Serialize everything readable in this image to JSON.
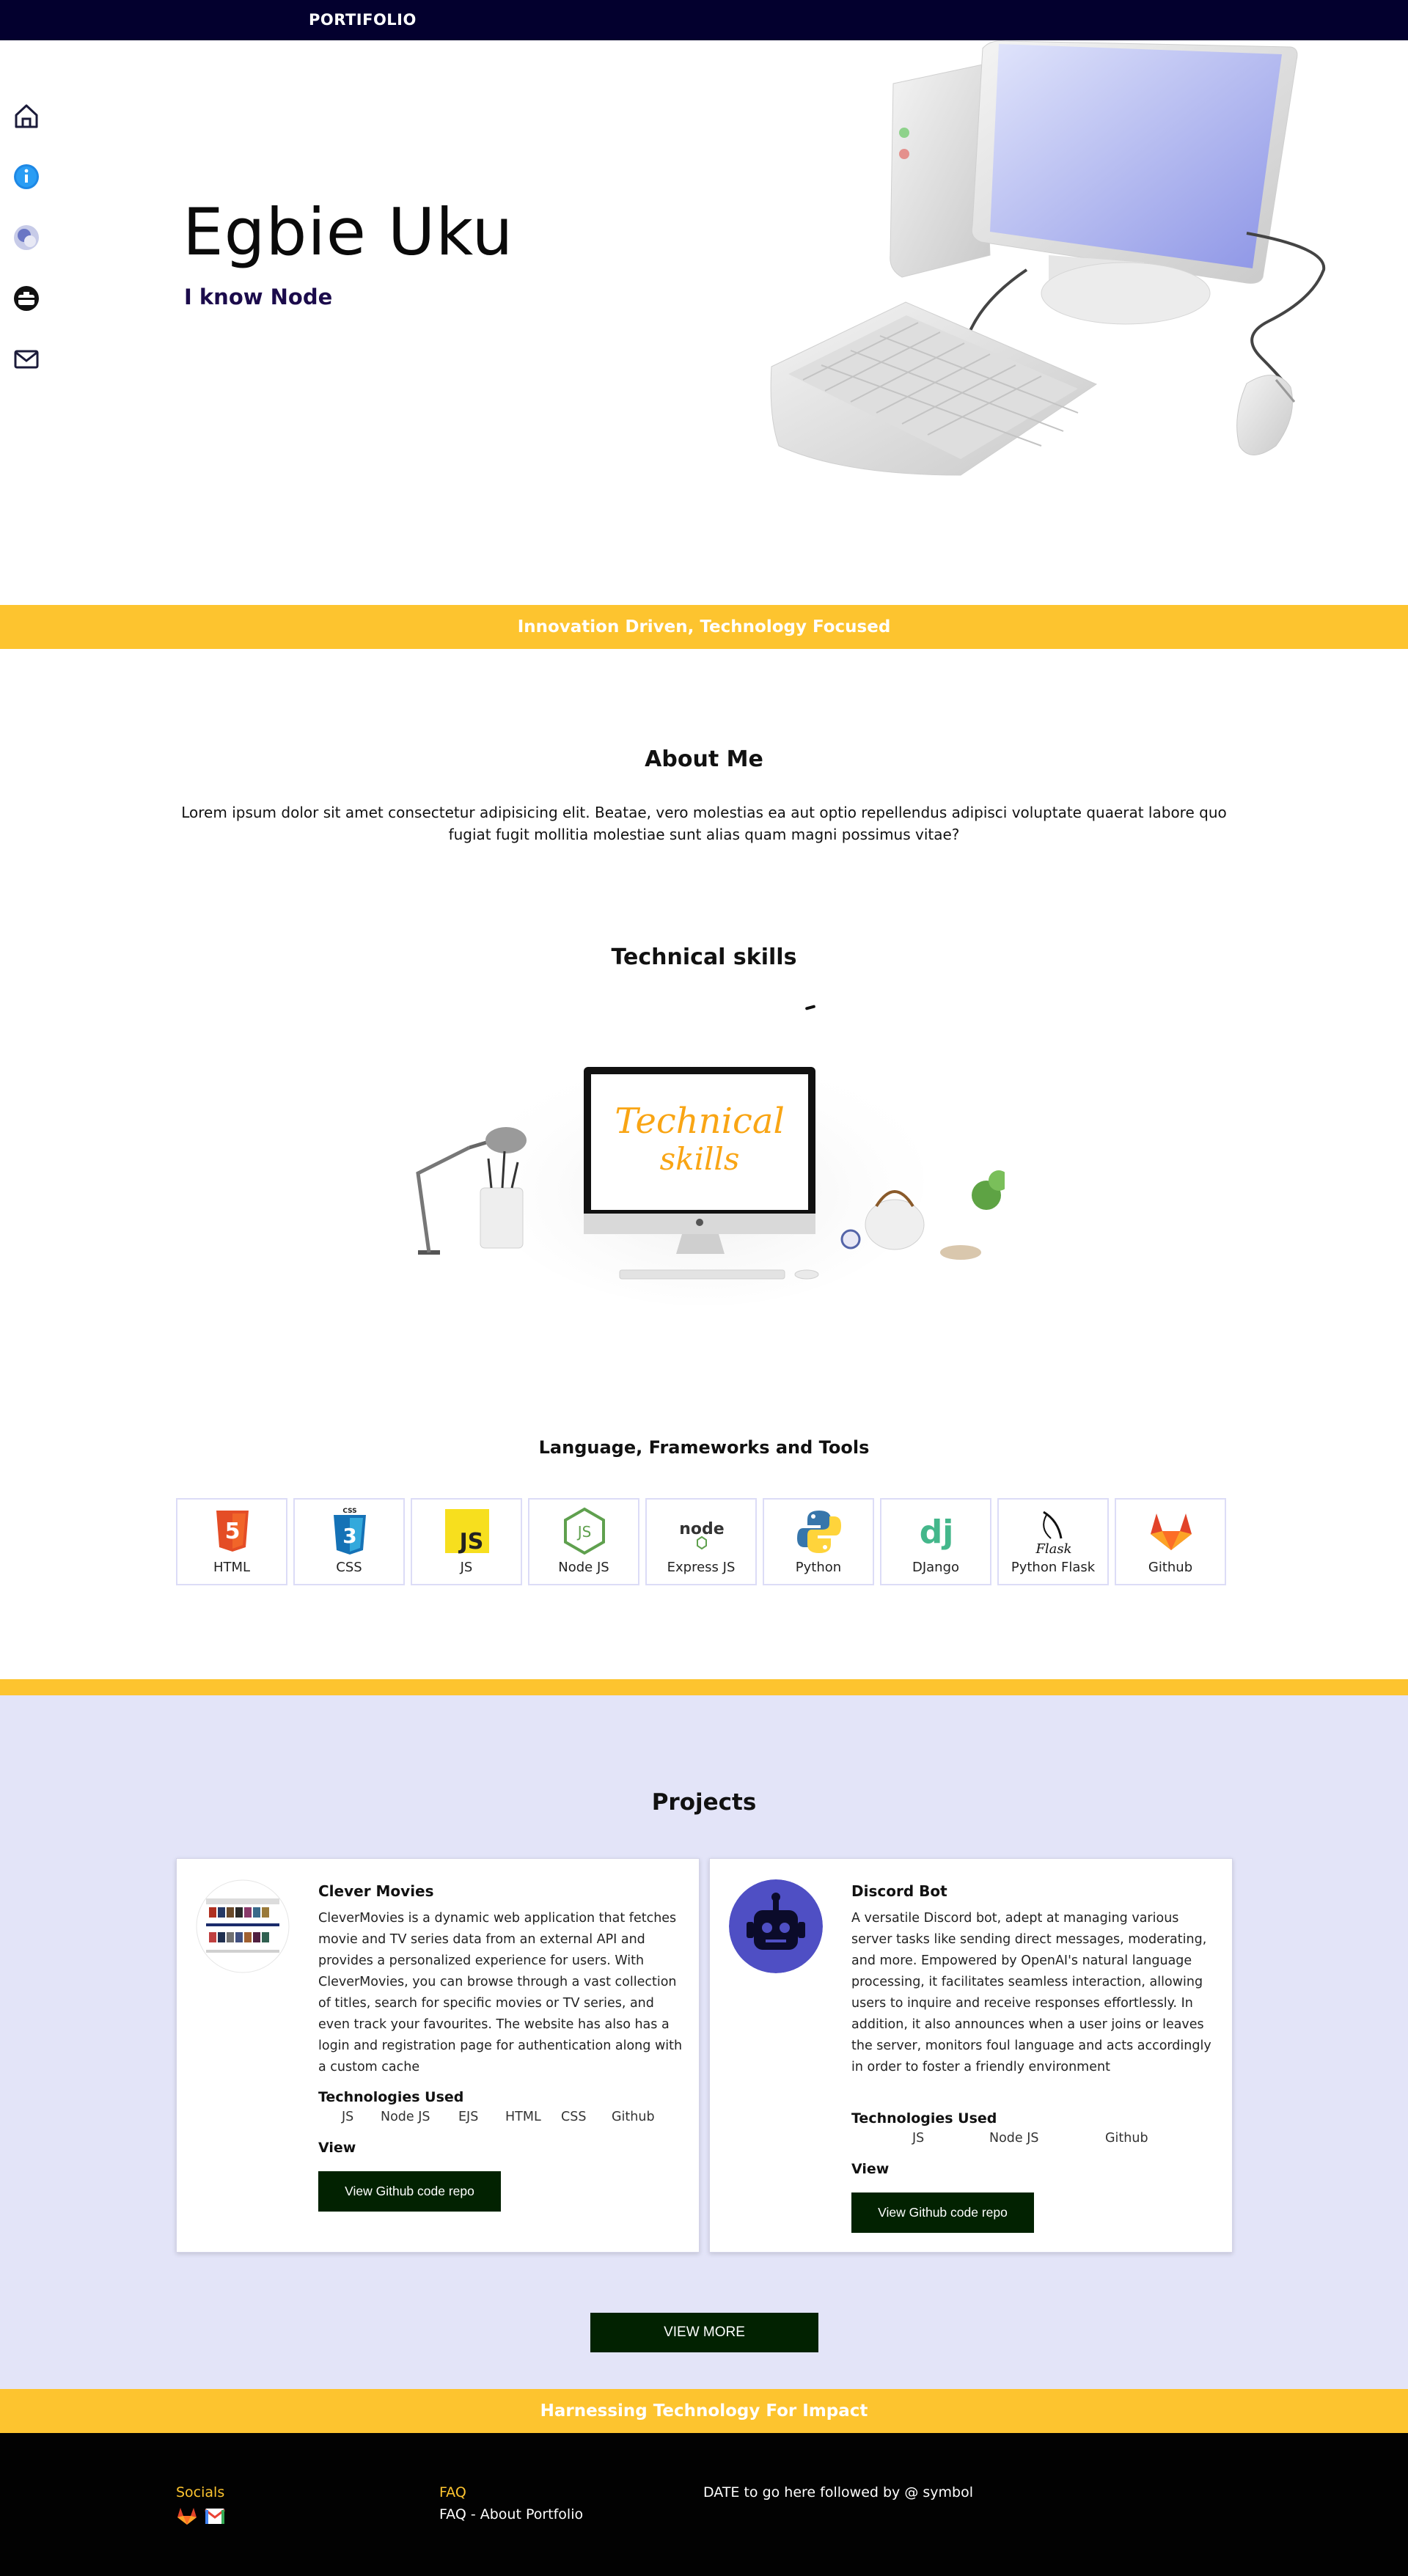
{
  "brand": "PORTIFOLIO",
  "hero": {
    "name": "Egbie Uku",
    "tagline": "I know Node"
  },
  "banners": {
    "top": "Innovation Driven, Technology Focused",
    "bottom": "Harnessing Technology For Impact"
  },
  "about": {
    "title": "About Me",
    "text": "Lorem ipsum dolor sit amet consectetur adipisicing elit. Beatae, vero molestias ea aut optio repellendus adipisci voluptate quaerat labore quo fugiat fugit mollitia molestiae sunt alias quam magni possimus vitae?"
  },
  "technical": {
    "title": "Technical skills",
    "art_text_line1": "Technical",
    "art_text_line2": "skills"
  },
  "languages": {
    "title": "Language, Frameworks and Tools",
    "items": [
      {
        "label": "HTML",
        "icon": "html5-icon"
      },
      {
        "label": "CSS",
        "icon": "css3-icon"
      },
      {
        "label": "JS",
        "icon": "javascript-icon"
      },
      {
        "label": "Node JS",
        "icon": "nodejs-icon"
      },
      {
        "label": "Express JS",
        "icon": "node-express-icon"
      },
      {
        "label": "Python",
        "icon": "python-icon"
      },
      {
        "label": "DJango",
        "icon": "django-icon"
      },
      {
        "label": "Python Flask",
        "icon": "flask-icon"
      },
      {
        "label": "Github",
        "icon": "gitlab-fox-icon"
      }
    ],
    "icon_text": {
      "html": "5",
      "css": "3",
      "css_tag": "CSS",
      "js": "JS",
      "node_js": "JS",
      "node_word": "node",
      "django": "dj",
      "flask": "Flask"
    }
  },
  "projects": {
    "title": "Projects",
    "tech_heading": "Technologies Used",
    "view_heading": "View",
    "button_label": "View Github code repo",
    "items": [
      {
        "title": "Clever Movies",
        "description": "CleverMovies is a dynamic web application that fetches movie and TV series data from an external API and provides a personalized experience for users. With CleverMovies, you can browse through a vast collection of titles, search for specific movies or TV series, and even track your favourites. The website has also has a login and registration page for authentication along with a custom cache",
        "tech": [
          "JS",
          "Node JS",
          "EJS",
          "HTML",
          "CSS",
          "Github"
        ]
      },
      {
        "title": "Discord Bot",
        "description": "A versatile Discord bot, adept at managing various server tasks like sending direct messages, moderating, and more. Empowered by OpenAI's natural language processing, it facilitates seamless interaction, allowing users to inquire and receive responses effortlessly. In addition, it also announces when a user joins or leaves the server, monitors foul language and acts accordingly in order to foster a friendly environment",
        "tech": [
          "JS",
          "Node JS",
          "Github"
        ]
      }
    ],
    "view_more": "VIEW MORE"
  },
  "footer": {
    "socials_label": "Socials",
    "faq_label": "FAQ",
    "faq_link": "FAQ - About Portfolio",
    "date_text": "DATE to go here followed by @ symbol"
  },
  "colors": {
    "navbar": "#03002e",
    "banner_yellow": "#fdc42f",
    "projects_bg": "#e3e4f8",
    "button_dark_green": "#022201",
    "footer": "#020202",
    "tagline_purple": "#1b0b4b"
  }
}
